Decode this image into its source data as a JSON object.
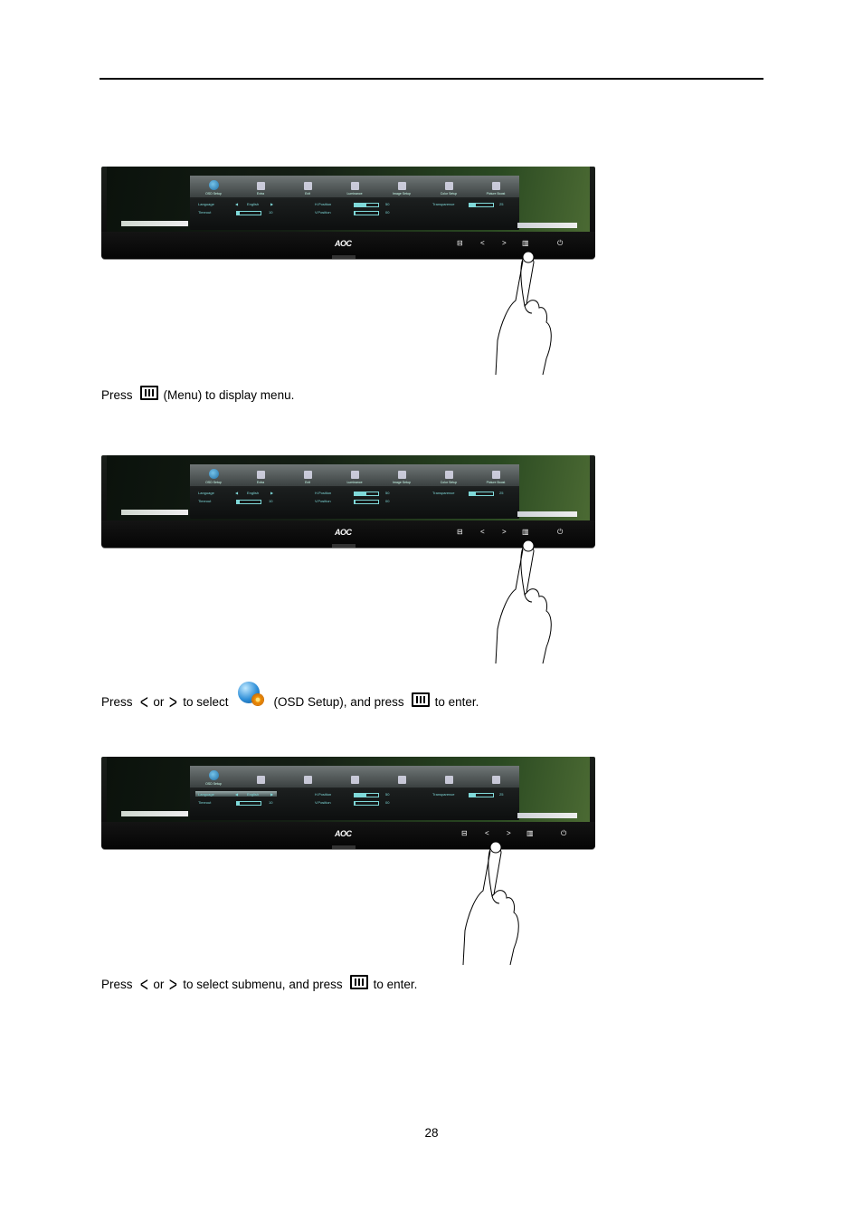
{
  "document": {
    "page_number": "28"
  },
  "osd": {
    "logo": "AOC",
    "tabs": [
      {
        "label": "OSD Setup",
        "icon": "osd-setup-globe-icon"
      },
      {
        "label": "Extra",
        "icon": "tools-icon"
      },
      {
        "label": "Exit",
        "icon": "exit-door-icon"
      },
      {
        "label": "Luminance",
        "icon": "luminance-icon"
      },
      {
        "label": "Image Setup",
        "icon": "image-setup-icon"
      },
      {
        "label": "Color Setup",
        "icon": "color-setup-icon"
      },
      {
        "label": "Picture Boost",
        "icon": "picture-boost-icon"
      }
    ],
    "settings": {
      "language_label": "Language",
      "language_value": "English",
      "timeout_label": "Timeout",
      "timeout_value": "10",
      "timeout_level": 0.1,
      "h_position_label": "H.Position",
      "h_position_value": "50",
      "h_position_level": 0.5,
      "v_position_label": "V.Position",
      "v_position_value": "00",
      "v_position_level": 0.0,
      "transparence_label": "Transparence",
      "transparence_value": "25",
      "transparence_level": 0.25
    },
    "bezel_buttons": [
      {
        "name": "auto-source-button",
        "glyph": "⊟"
      },
      {
        "name": "left-button",
        "glyph": "<"
      },
      {
        "name": "right-button",
        "glyph": ">"
      },
      {
        "name": "menu-button",
        "glyph": "▥"
      },
      {
        "name": "power-button",
        "glyph": "⏻"
      }
    ]
  },
  "steps": [
    {
      "pressed": "menu",
      "caption": {
        "press": "Press",
        "rest": "(Menu) to display menu."
      }
    },
    {
      "pressed": "menu",
      "caption": {
        "press": "Press",
        "or": "or",
        "to_select": "to select",
        "osd_setup": "(OSD Setup), and press",
        "to_enter": "to enter."
      }
    },
    {
      "pressed": "left",
      "caption": {
        "press": "Press",
        "or": "or",
        "rest": "to select submenu, and press",
        "to_enter": "to enter."
      }
    }
  ]
}
